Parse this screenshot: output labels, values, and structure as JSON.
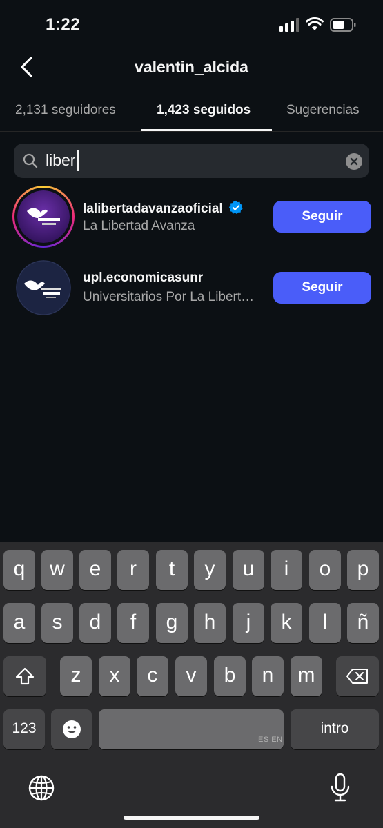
{
  "status_bar": {
    "time": "1:22"
  },
  "header": {
    "title": "valentin_alcida"
  },
  "tabs": [
    {
      "label": "2,131 seguidores",
      "active": false
    },
    {
      "label": "1,423 seguidos",
      "active": true
    },
    {
      "label": "Sugerencias",
      "active": false
    }
  ],
  "search": {
    "value": "liber"
  },
  "results": [
    {
      "username": "lalibertadavanzaoficial",
      "full_name": "La Libertad Avanza",
      "verified": true,
      "has_story": true,
      "button": "Seguir"
    },
    {
      "username": "upl.economicasunr",
      "full_name": "Universitarios Por La Libertad Económicas UNR",
      "verified": false,
      "has_story": false,
      "button": "Seguir"
    }
  ],
  "keyboard": {
    "row1": [
      "q",
      "w",
      "e",
      "r",
      "t",
      "y",
      "u",
      "i",
      "o",
      "p"
    ],
    "row2": [
      "a",
      "s",
      "d",
      "f",
      "g",
      "h",
      "j",
      "k",
      "l",
      "ñ"
    ],
    "row3": [
      "z",
      "x",
      "c",
      "v",
      "b",
      "n",
      "m"
    ],
    "numbers_key": "123",
    "return_key": "intro",
    "space_lang": "ES EN"
  },
  "colors": {
    "accent": "#4a5df9",
    "background": "#0c1014",
    "verified": "#0095f6"
  }
}
